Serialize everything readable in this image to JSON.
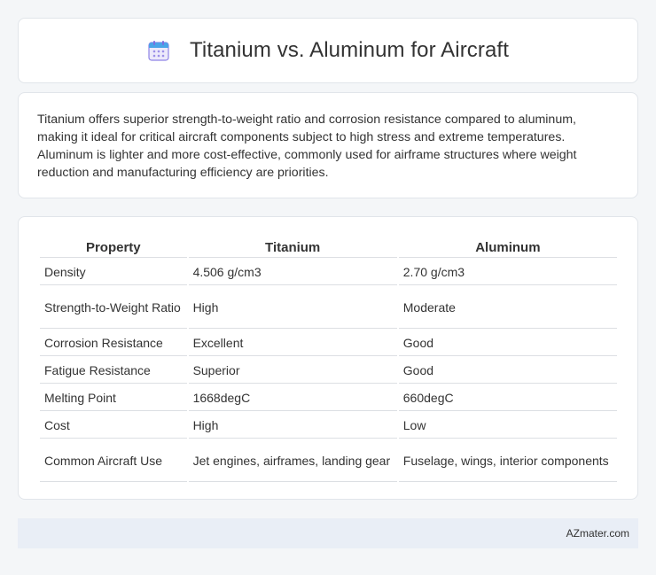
{
  "header": {
    "title": "Titanium vs. Aluminum for Aircraft",
    "icon": "calendar-icon",
    "icon_color": "#7b6ee0"
  },
  "description": "Titanium offers superior strength-to-weight ratio and corrosion resistance compared to aluminum, making it ideal for critical aircraft components subject to high stress and extreme temperatures. Aluminum is lighter and more cost-effective, commonly used for airframe structures where weight reduction and manufacturing efficiency are priorities.",
  "table": {
    "headers": [
      "Property",
      "Titanium",
      "Aluminum"
    ],
    "rows": [
      [
        "Density",
        "4.506 g/cm3",
        "2.70 g/cm3"
      ],
      [
        "Strength-to-Weight Ratio",
        "High",
        "Moderate"
      ],
      [
        "Corrosion Resistance",
        "Excellent",
        "Good"
      ],
      [
        "Fatigue Resistance",
        "Superior",
        "Good"
      ],
      [
        "Melting Point",
        "1668degC",
        "660degC"
      ],
      [
        "Cost",
        "High",
        "Low"
      ],
      [
        "Common Aircraft Use",
        "Jet engines, airframes, landing gear",
        "Fuselage, wings, interior components"
      ]
    ]
  },
  "footer": {
    "site": "AZmater.com"
  }
}
